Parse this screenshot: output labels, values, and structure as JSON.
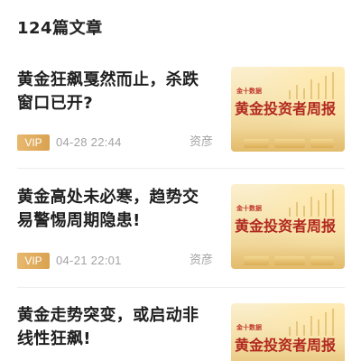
{
  "header": {
    "article_count": "124篇文章"
  },
  "articles": [
    {
      "title": "黄金狂飙戛然而止，杀跌窗口已开?",
      "badge": "VIP",
      "time": "04-28 22:44",
      "author": "资彦",
      "thumb_brand": "金十数据",
      "thumb_title": "黄金投资者周报"
    },
    {
      "title": "黄金高处未必寒，趋势交易警惕周期隐患!",
      "badge": "VIP",
      "time": "04-21 22:01",
      "author": "资彦",
      "thumb_brand": "金十数据",
      "thumb_title": "黄金投资者周报"
    },
    {
      "title": "黄金走势突变，或启动非线性狂飙!",
      "thumb_brand": "金十数据",
      "thumb_title": "黄金投资者周报"
    }
  ],
  "colors": {
    "vip_badge": "#dca555",
    "meta_text": "#a2a2a2",
    "thumb_title": "#b1281f",
    "title_text": "#1f1f1f"
  }
}
